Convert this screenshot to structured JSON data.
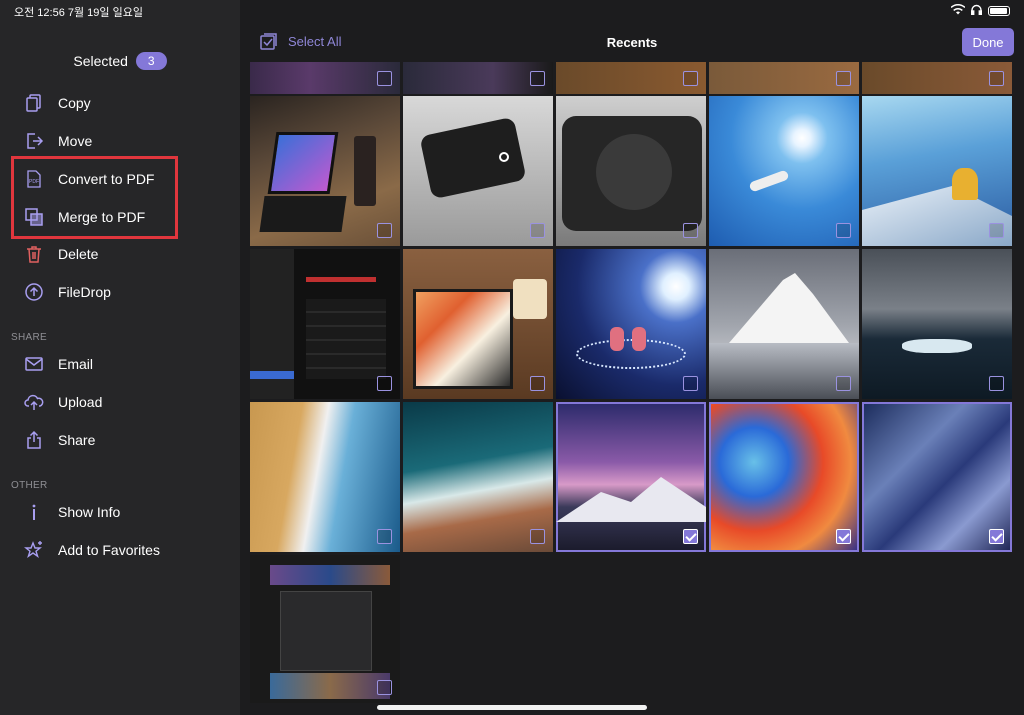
{
  "status": {
    "time": "오전 12:56  7월 19일 일요일"
  },
  "sidebar": {
    "selected_label": "Selected",
    "selected_count": "3",
    "actions": [
      {
        "label": "Copy",
        "icon": "copy-icon"
      },
      {
        "label": "Move",
        "icon": "move-icon"
      },
      {
        "label": "Convert to PDF",
        "icon": "pdf-icon"
      },
      {
        "label": "Merge to PDF",
        "icon": "merge-icon"
      },
      {
        "label": "Delete",
        "icon": "trash-icon"
      },
      {
        "label": "FileDrop",
        "icon": "filedrop-icon"
      }
    ],
    "share_header": "SHARE",
    "share": [
      {
        "label": "Email",
        "icon": "mail-icon"
      },
      {
        "label": "Upload",
        "icon": "cloud-upload-icon"
      },
      {
        "label": "Share",
        "icon": "share-icon"
      }
    ],
    "other_header": "OTHER",
    "other": [
      {
        "label": "Show Info",
        "icon": "info-icon"
      },
      {
        "label": "Add to Favorites",
        "icon": "star-icon"
      }
    ]
  },
  "topbar": {
    "select_all": "Select All",
    "title": "Recents",
    "done": "Done"
  },
  "colors": {
    "accent": "#8478d8",
    "sidebar_bg": "#262628",
    "main_bg": "#1c1c1e",
    "highlight": "#e0363d"
  },
  "grid": {
    "selected_photos": [
      "row3-col3",
      "row3-col4",
      "row3-col5"
    ]
  }
}
